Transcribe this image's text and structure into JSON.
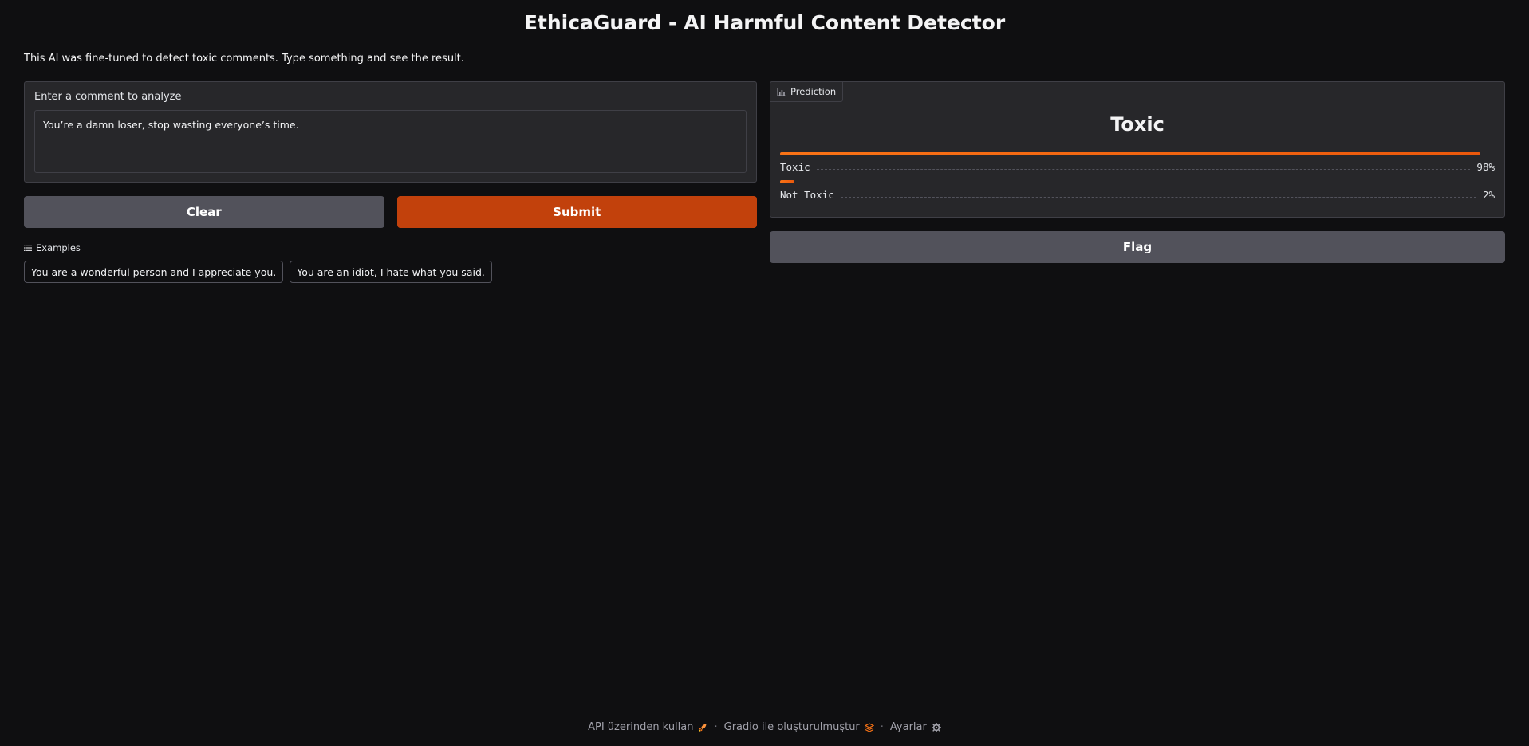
{
  "app": {
    "title": "EthicaGuard - AI Harmful Content Detector",
    "description": "This AI was fine-tuned to detect toxic comments. Type something and see the result."
  },
  "input": {
    "label": "Enter a comment to analyze",
    "value": "You’re a damn loser, stop wasting everyone’s time."
  },
  "buttons": {
    "clear": "Clear",
    "submit": "Submit",
    "flag": "Flag"
  },
  "prediction": {
    "tag_label": "Prediction",
    "tag_icon": "bar-chart-icon",
    "label": "Toxic",
    "confidences": [
      {
        "label": "Toxic",
        "value": 0.98,
        "display": "98%"
      },
      {
        "label": "Not Toxic",
        "value": 0.02,
        "display": "2%"
      }
    ]
  },
  "examples": {
    "header": "Examples",
    "header_icon": "list-icon",
    "items": [
      "You are a wonderful person and I appreciate you.",
      "You are an idiot, I hate what you said."
    ]
  },
  "footer": {
    "api_label": "API üzerinden kullan",
    "api_icon": "rocket-icon",
    "built_label": "Gradio ile oluşturulmuştur",
    "built_icon": "gradio-logo-icon",
    "settings_label": "Ayarlar",
    "settings_icon": "gear-icon",
    "separator": "·"
  },
  "colors": {
    "background": "#0f0f11",
    "panel": "#27272a",
    "primary": "#c2410c",
    "secondary": "#52525b",
    "accent": "#f97316"
  }
}
